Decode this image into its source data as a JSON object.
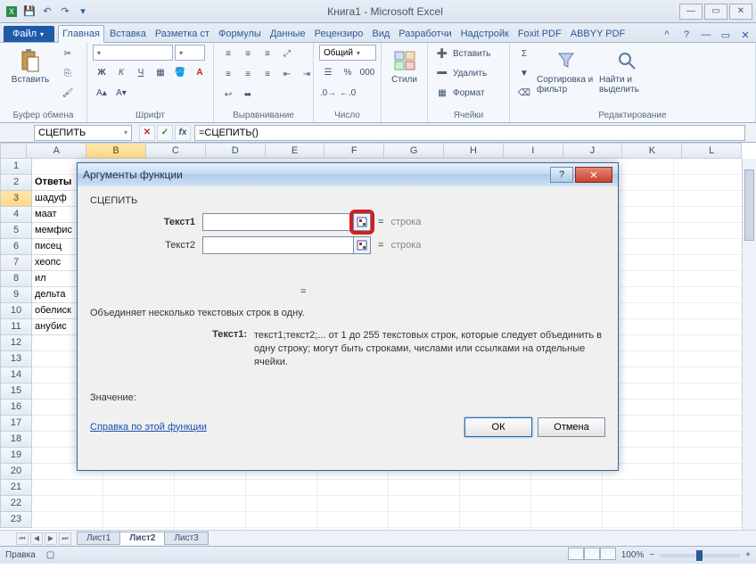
{
  "title": "Книга1  -  Microsoft Excel",
  "tabs": {
    "file": "Файл",
    "items": [
      "Главная",
      "Вставка",
      "Разметка ст",
      "Формулы",
      "Данные",
      "Рецензиро",
      "Вид",
      "Разработчи",
      "Надстройк",
      "Foxit PDF",
      "ABBYY PDF"
    ]
  },
  "ribbon": {
    "clipboard": {
      "paste": "Вставить",
      "label": "Буфер обмена"
    },
    "font": {
      "size": "",
      "name": "",
      "label": "Шрифт"
    },
    "alignment": {
      "label": "Выравнивание"
    },
    "number": {
      "format": "Общий",
      "label": "Число"
    },
    "styles": {
      "styles": "Стили",
      "label": ""
    },
    "cells": {
      "insert": "Вставить",
      "delete": "Удалить",
      "format": "Формат",
      "label": "Ячейки"
    },
    "editing": {
      "sort": "Сортировка и фильтр",
      "find": "Найти и выделить",
      "label": "Редактирование"
    }
  },
  "namebox": "СЦЕПИТЬ",
  "formula": "=СЦЕПИТЬ()",
  "cols": [
    "A",
    "B",
    "C",
    "D",
    "E",
    "F",
    "G",
    "H",
    "I",
    "J",
    "K",
    "L"
  ],
  "rows": [
    "1",
    "2",
    "3",
    "4",
    "5",
    "6",
    "7",
    "8",
    "9",
    "10",
    "11",
    "12",
    "13",
    "14",
    "15",
    "16",
    "17",
    "18",
    "19",
    "20",
    "21",
    "22",
    "23"
  ],
  "cells": {
    "a2": "Ответы",
    "a3": "шадуф",
    "a4": "маат",
    "a5": "мемфис",
    "a6": "писец",
    "a7": "хеопс",
    "a8": "ил",
    "a9": "дельта",
    "a10": "обелиск",
    "a11": "анубис"
  },
  "sheets": [
    "Лист1",
    "Лист2",
    "Лист3"
  ],
  "active_sheet": 1,
  "status": {
    "mode": "Правка",
    "zoom": "100%"
  },
  "dialog": {
    "title": "Аргументы функции",
    "fn": "СЦЕПИТЬ",
    "arg1_label": "Текст1",
    "arg2_label": "Текст2",
    "hint": "строка",
    "result_eq": "=",
    "desc": "Объединяет несколько текстовых строк в одну.",
    "arg_desc_label": "Текст1:",
    "arg_desc": "текст1;текст2;... от 1 до 255 текстовых строк, которые следует объединить в одну строку; могут быть строками, числами или ссылками на отдельные ячейки.",
    "value_label": "Значение:",
    "help_link": "Справка по этой функции",
    "ok": "ОК",
    "cancel": "Отмена"
  }
}
